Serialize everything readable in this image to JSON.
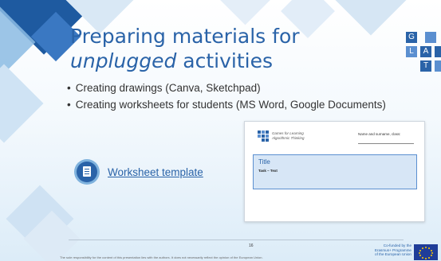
{
  "slide": {
    "title_line1": "Preparing materials for",
    "title_line2_emph": "unplugged",
    "title_line2_rest": " activities",
    "bullets": [
      "Creating drawings (Canva, Sketchpad)",
      "Creating worksheets for students (MS Word, Google Documents)"
    ],
    "link_label": "Worksheet template",
    "logo_letters": [
      "G",
      "L",
      "A",
      "T"
    ]
  },
  "worksheet_preview": {
    "logo_text_line1": "Games for Learning",
    "logo_text_line2": "Algorithmic Thinking",
    "name_label": "Name and surname, class:",
    "box_title": "Title",
    "task_label": "Task – Text"
  },
  "footer": {
    "page_number": "16",
    "disclaimer": "The sole responsibility for the content of this presentation lies with the authors. It does not necessarily reflect the opinion of the European Union.",
    "cofunded_line1": "Co-funded by the",
    "cofunded_line2": "Erasmus+ Programme",
    "cofunded_line3": "of the European Union"
  },
  "colors": {
    "title_blue": "#2a63a8",
    "accent_light": "#7fb2dd",
    "eu_blue": "#1f3d99",
    "eu_yellow": "#ffcc00"
  }
}
